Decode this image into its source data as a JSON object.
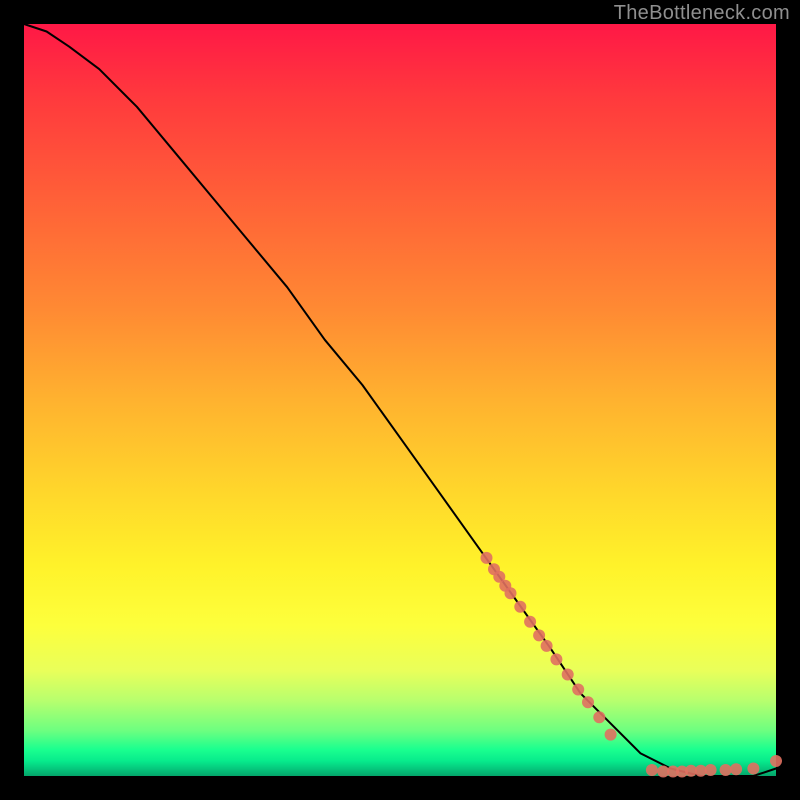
{
  "watermark": "TheBottleneck.com",
  "chart_data": {
    "type": "line",
    "title": "",
    "xlabel": "",
    "ylabel": "",
    "xlim": [
      0,
      100
    ],
    "ylim": [
      0,
      100
    ],
    "grid": false,
    "legend": false,
    "curve": {
      "name": "bottleneck-curve",
      "x": [
        0,
        3,
        6,
        10,
        15,
        20,
        25,
        30,
        35,
        40,
        45,
        50,
        55,
        60,
        65,
        70,
        74,
        78,
        82,
        86,
        90,
        94,
        97,
        100
      ],
      "y": [
        100,
        99,
        97,
        94,
        89,
        83,
        77,
        71,
        65,
        58,
        52,
        45,
        38,
        31,
        24,
        17,
        11,
        7,
        3,
        1,
        0,
        0,
        0,
        1
      ]
    },
    "series": [
      {
        "name": "markers-diagonal",
        "type": "scatter",
        "color": "#e07060",
        "x": [
          61.5,
          62.5,
          63.2,
          64.0,
          64.7,
          66.0,
          67.3,
          68.5,
          69.5,
          70.8,
          72.3,
          73.7,
          75.0,
          76.5,
          78.0
        ],
        "y": [
          29.0,
          27.5,
          26.5,
          25.3,
          24.3,
          22.5,
          20.5,
          18.7,
          17.3,
          15.5,
          13.5,
          11.5,
          9.8,
          7.8,
          5.5
        ]
      },
      {
        "name": "markers-bottom",
        "type": "scatter",
        "color": "#e07060",
        "x": [
          83.5,
          85.0,
          86.3,
          87.5,
          88.7,
          90.0,
          91.3,
          93.3,
          94.7,
          97.0,
          100.0
        ],
        "y": [
          0.8,
          0.6,
          0.6,
          0.6,
          0.7,
          0.7,
          0.8,
          0.8,
          0.9,
          1.0,
          2.0
        ]
      }
    ]
  }
}
